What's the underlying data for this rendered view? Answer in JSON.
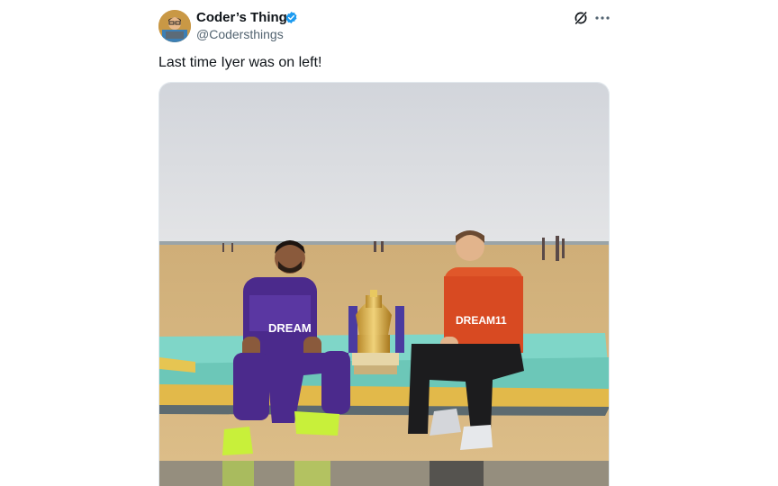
{
  "author": {
    "display_name": "Coder’s Things",
    "handle": "@Codersthings",
    "verified_color": "#1d9bf0"
  },
  "actions": {
    "grok_icon": "grok-icon",
    "more_icon": "more-dots-icon"
  },
  "tweet": {
    "text": "Last time Iyer was on left!"
  },
  "media": {
    "left_jersey_text": "DREAM",
    "right_jersey_text": "DREAM11"
  },
  "colors": {
    "kkr_purple": "#4b2a8c",
    "srh_orange": "#e0572a",
    "boat_teal": "#7fd6c8",
    "boat_yellow": "#e2b94a",
    "sand": "#d8b67c",
    "sky": "#d2d5db"
  }
}
